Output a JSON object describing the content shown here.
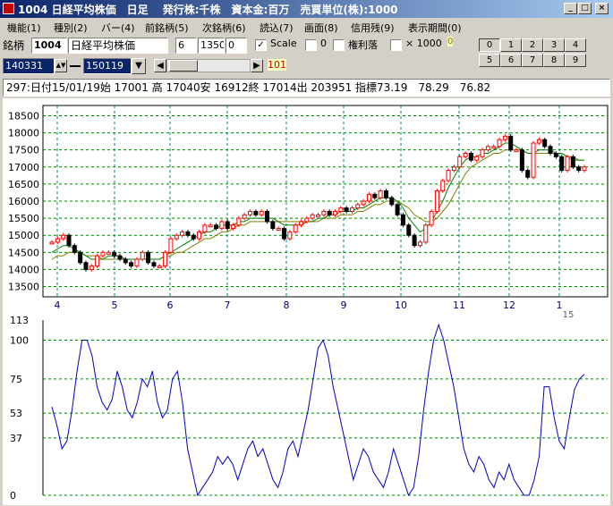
{
  "window": {
    "title": "1004 日経平均株価　日足　 発行株:千株　資本金:百万　売買単位(株):1000",
    "buttons": [
      "_",
      "□",
      "×"
    ]
  },
  "menu": [
    "機能(1)",
    "種別(2)",
    "バー(4)",
    "前銘柄(5)",
    "次銘柄(6)",
    "読込(7)",
    "画面(8)",
    "信用残(9)",
    "表示期間(0)"
  ],
  "toolbar": {
    "code_label": "銘柄",
    "code": "1004",
    "name": "日経平均株価",
    "field1": "6",
    "field2": "1350",
    "field3": "0",
    "scale_label": "Scale",
    "scale_checked": true,
    "box2_value": "0",
    "kenri_label": "権利落",
    "x1000_label": "× 1000",
    "x1000_value": "0",
    "from_date": "140331",
    "to_date": "150119",
    "scroll_value": "101",
    "num_buttons_row1": [
      "0",
      "1",
      "2",
      "3",
      "4"
    ],
    "num_buttons_row2": [
      "5",
      "6",
      "7",
      "8",
      "9"
    ],
    "selected_num": "0"
  },
  "status": "297:日付15/01/19始 17001 高 17040安 16912終 17014出 203951 指標73.19　78.29　76.82",
  "chart_data": [
    {
      "type": "candlestick",
      "yticks": [
        13500,
        14000,
        14500,
        15000,
        15500,
        16000,
        16500,
        17000,
        17500,
        18000,
        18500
      ],
      "ylim": [
        13200,
        18800
      ],
      "month_labels": [
        "4",
        "5",
        "6",
        "7",
        "8",
        "9",
        "10",
        "11",
        "12",
        "1"
      ],
      "year_label": "15",
      "close": [
        14800,
        14900,
        15000,
        14700,
        14500,
        14200,
        14000,
        14100,
        14400,
        14500,
        14500,
        14400,
        14300,
        14200,
        14100,
        14300,
        14500,
        14200,
        14100,
        14100,
        14500,
        14900,
        15000,
        15100,
        15000,
        14900,
        15100,
        15300,
        15300,
        15200,
        15400,
        15200,
        15300,
        15500,
        15600,
        15700,
        15600,
        15700,
        15400,
        15200,
        15200,
        14900,
        15100,
        15300,
        15400,
        15500,
        15600,
        15600,
        15700,
        15600,
        15700,
        15800,
        15700,
        15800,
        15900,
        16000,
        16200,
        16100,
        16300,
        16100,
        15900,
        15600,
        15300,
        15000,
        14700,
        14800,
        15300,
        15700,
        16300,
        16600,
        16900,
        17000,
        17300,
        17400,
        17200,
        17300,
        17500,
        17600,
        17600,
        17800,
        17900,
        17500,
        17500,
        16900,
        16700,
        17700,
        17800,
        17600,
        17400,
        17300,
        16900,
        17300,
        17000,
        16900,
        17000
      ],
      "ma_short": [
        14500,
        14600,
        14700,
        14700,
        14600,
        14500,
        14400,
        14300,
        14300,
        14300,
        14400,
        14400,
        14400,
        14300,
        14300,
        14300,
        14300,
        14300,
        14300,
        14300,
        14400,
        14500,
        14600,
        14700,
        14800,
        14900,
        15000,
        15100,
        15100,
        15200,
        15300,
        15300,
        15300,
        15400,
        15400,
        15500,
        15500,
        15500,
        15500,
        15500,
        15400,
        15300,
        15300,
        15300,
        15300,
        15400,
        15400,
        15500,
        15500,
        15600,
        15600,
        15700,
        15700,
        15700,
        15800,
        15800,
        15900,
        16000,
        16100,
        16100,
        16100,
        16000,
        15800,
        15500,
        15300,
        15100,
        15200,
        15400,
        15700,
        16000,
        16400,
        16700,
        17000,
        17200,
        17300,
        17300,
        17400,
        17400,
        17500,
        17600,
        17700,
        17700,
        17600,
        17500,
        17400,
        17400,
        17500,
        17500,
        17500,
        17400,
        17400,
        17300,
        17200,
        17200,
        17200
      ],
      "ma_long": [
        14300,
        14400,
        14400,
        14500,
        14500,
        14500,
        14400,
        14400,
        14400,
        14300,
        14300,
        14300,
        14300,
        14300,
        14300,
        14300,
        14300,
        14300,
        14300,
        14300,
        14400,
        14400,
        14500,
        14500,
        14600,
        14700,
        14800,
        14900,
        14900,
        15000,
        15100,
        15100,
        15200,
        15300,
        15300,
        15400,
        15400,
        15400,
        15400,
        15400,
        15400,
        15400,
        15400,
        15400,
        15400,
        15400,
        15400,
        15400,
        15500,
        15500,
        15500,
        15600,
        15600,
        15600,
        15700,
        15700,
        15800,
        15900,
        15900,
        16000,
        16000,
        16000,
        15900,
        15800,
        15600,
        15500,
        15400,
        15400,
        15500,
        15700,
        15900,
        16200,
        16500,
        16800,
        17000,
        17100,
        17200,
        17300,
        17400,
        17400,
        17500,
        17500,
        17500,
        17500,
        17400,
        17400,
        17400,
        17400,
        17400,
        17400,
        17400,
        17300,
        17300,
        17200,
        17200
      ]
    },
    {
      "type": "line",
      "yticks": [
        0,
        37,
        53,
        75,
        100
      ],
      "top_label": "113",
      "ylim": [
        0,
        113
      ],
      "values": [
        57,
        45,
        30,
        35,
        55,
        80,
        100,
        100,
        90,
        70,
        60,
        55,
        62,
        80,
        70,
        55,
        50,
        60,
        75,
        70,
        80,
        60,
        50,
        55,
        75,
        80,
        60,
        30,
        15,
        0,
        5,
        10,
        15,
        25,
        20,
        25,
        20,
        10,
        20,
        30,
        35,
        25,
        30,
        20,
        10,
        5,
        15,
        30,
        35,
        25,
        40,
        55,
        75,
        95,
        100,
        90,
        70,
        55,
        40,
        25,
        10,
        20,
        30,
        25,
        15,
        10,
        5,
        15,
        30,
        20,
        10,
        0,
        5,
        25,
        55,
        80,
        100,
        110,
        100,
        85,
        70,
        50,
        30,
        20,
        15,
        25,
        20,
        10,
        5,
        15,
        10,
        20,
        10,
        5,
        0,
        0,
        10,
        25,
        70,
        70,
        50,
        35,
        30,
        50,
        68,
        75,
        78
      ]
    }
  ]
}
